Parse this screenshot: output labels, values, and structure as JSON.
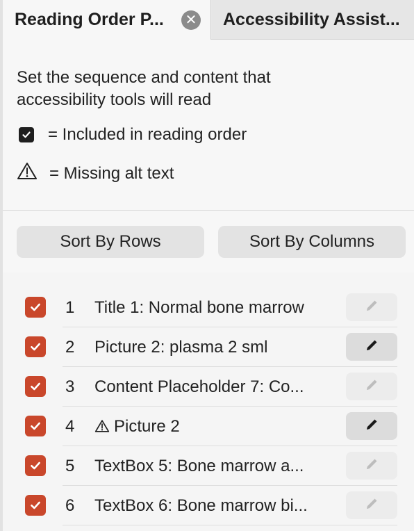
{
  "tabs": [
    {
      "label": "Reading Order P...",
      "active": true,
      "closable": true
    },
    {
      "label": "Accessibility Assist...",
      "active": false
    }
  ],
  "intro": {
    "text": "Set the sequence and content that accessibility tools will read"
  },
  "legend": {
    "included_label": "= Included in reading order",
    "missing_label": "= Missing alt text"
  },
  "sort": {
    "rows_label": "Sort By Rows",
    "columns_label": "Sort By Columns"
  },
  "items": [
    {
      "number": "1",
      "label": "Title 1: Normal bone marrow",
      "checked": true,
      "warning": false,
      "edit_enabled": false
    },
    {
      "number": "2",
      "label": "Picture 2: plasma 2 sml",
      "checked": true,
      "warning": false,
      "edit_enabled": true
    },
    {
      "number": "3",
      "label": "Content Placeholder 7: Co...",
      "checked": true,
      "warning": false,
      "edit_enabled": false
    },
    {
      "number": "4",
      "label": "Picture 2",
      "checked": true,
      "warning": true,
      "edit_enabled": true
    },
    {
      "number": "5",
      "label": "TextBox 5: Bone marrow a...",
      "checked": true,
      "warning": false,
      "edit_enabled": false
    },
    {
      "number": "6",
      "label": "TextBox 6: Bone marrow bi...",
      "checked": true,
      "warning": false,
      "edit_enabled": false
    }
  ],
  "colors": {
    "checkbox_accent": "#c9472b",
    "legend_checkbox": "#1f1f1f"
  },
  "icons": {
    "tab_close": "close-icon",
    "check": "checkmark-icon",
    "warning": "warning-triangle-icon",
    "edit": "pencil-icon"
  }
}
